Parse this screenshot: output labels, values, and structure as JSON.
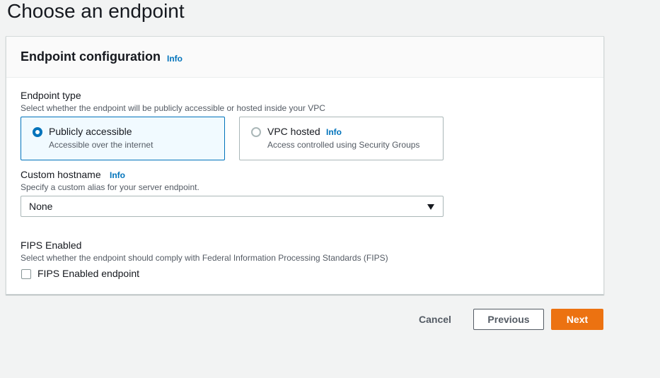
{
  "page": {
    "title": "Choose an endpoint"
  },
  "panel": {
    "title": "Endpoint configuration",
    "info": "Info"
  },
  "endpoint_type": {
    "label": "Endpoint type",
    "description": "Select whether the endpoint will be publicly accessible or hosted inside your VPC",
    "options": [
      {
        "label": "Publicly accessible",
        "description": "Accessible over the internet",
        "selected": true
      },
      {
        "label": "VPC hosted",
        "info": "Info",
        "description": "Access controlled using Security Groups",
        "selected": false
      }
    ]
  },
  "custom_hostname": {
    "label": "Custom hostname",
    "info": "Info",
    "description": "Specify a custom alias for your server endpoint.",
    "selected_value": "None"
  },
  "fips": {
    "label": "FIPS Enabled",
    "description": "Select whether the endpoint should comply with Federal Information Processing Standards (FIPS)",
    "checkbox_label": "FIPS Enabled endpoint",
    "checked": false
  },
  "footer": {
    "cancel": "Cancel",
    "previous": "Previous",
    "next": "Next"
  },
  "colors": {
    "accent": "#0073bb",
    "primary_button": "#ec7211",
    "background": "#f2f3f3"
  }
}
